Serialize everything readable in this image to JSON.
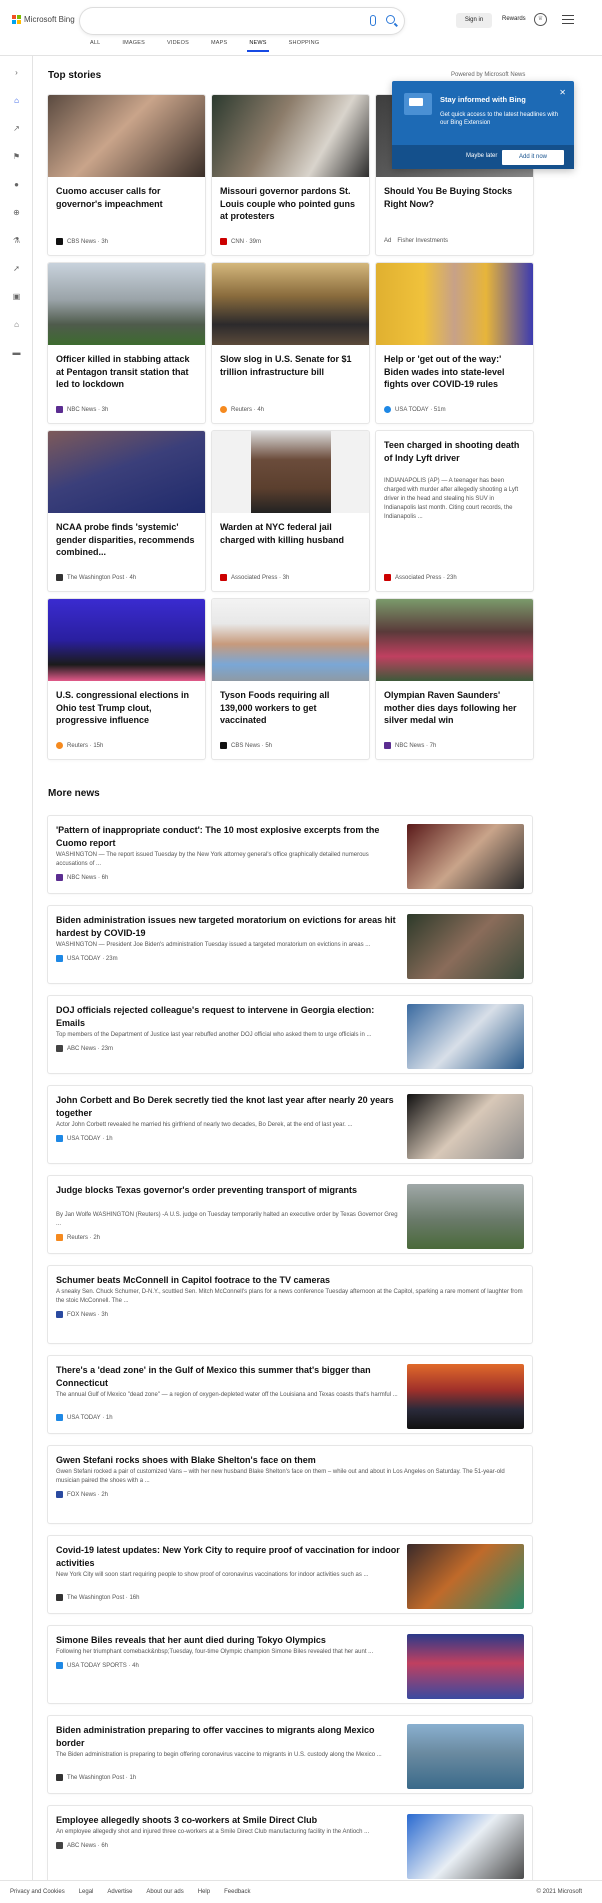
{
  "header": {
    "logo_text": "Microsoft Bing",
    "signin": "Sign in",
    "rewards": "Rewards",
    "tabs": [
      "ALL",
      "IMAGES",
      "VIDEOS",
      "MAPS",
      "NEWS",
      "SHOPPING"
    ],
    "active_tab": "NEWS"
  },
  "colors": {
    "accent": "#174ae4",
    "popup_bg": "#1d6ab5"
  },
  "top_stories": {
    "title": "Top stories",
    "powered_by": "Powered by Microsoft News",
    "cards": [
      {
        "headline": "Cuomo accuser calls for governor's impeachment",
        "source": "CBS News · 3h"
      },
      {
        "headline": "Missouri governor pardons St. Louis couple who pointed guns at protesters",
        "source": "CNN · 39m"
      },
      {
        "headline": "Should You Be Buying Stocks Right Now?",
        "source": "Fisher Investments",
        "ad": "Ad"
      },
      {
        "headline": "Officer killed in stabbing attack at Pentagon transit station that led to lockdown",
        "source": "NBC News · 3h"
      },
      {
        "headline": "Slow slog in U.S. Senate for $1 trillion infrastructure bill",
        "source": "Reuters · 4h"
      },
      {
        "headline": "Help or 'get out of the way:' Biden wades into state-level fights over COVID-19 rules",
        "source": "USA TODAY · 51m"
      },
      {
        "headline": "NCAA probe finds 'systemic' gender disparities, recommends combined...",
        "source": "The Washington Post · 4h"
      },
      {
        "headline": "Warden at NYC federal jail charged with killing husband",
        "source": "Associated Press · 3h"
      },
      {
        "headline": "Teen charged in shooting death of Indy Lyft driver",
        "snippet": "INDIANAPOLIS (AP) — A teenager has been charged with murder after allegedly shooting a Lyft driver in the head and stealing his SUV in Indianapolis last month. Citing court records, the Indianapolis ...",
        "source": "Associated Press · 23h"
      },
      {
        "headline": "U.S. congressional elections in Ohio test Trump clout, progressive influence",
        "source": "Reuters · 15h"
      },
      {
        "headline": "Tyson Foods requiring all 139,000 workers to get vaccinated",
        "source": "CBS News · 5h"
      },
      {
        "headline": "Olympian Raven Saunders' mother dies days following her silver medal win",
        "source": "NBC News · 7h"
      }
    ]
  },
  "popup": {
    "title": "Stay informed with Bing",
    "text": "Get quick access to the latest headlines with our Bing Extension",
    "later": "Maybe later",
    "add": "Add it now"
  },
  "more_news": {
    "title": "More news",
    "items": [
      {
        "headline": "'Pattern of inappropriate conduct': The 10 most explosive excerpts from the Cuomo report",
        "snippet": "WASHINGTON — The report issued Tuesday by the New York attorney general's office graphically detailed numerous accusations of ...",
        "source": "NBC News · 6h"
      },
      {
        "headline": "Biden administration issues new targeted moratorium on evictions for areas hit hardest by COVID-19",
        "snippet": "WASHINGTON — President Joe Biden's administration Tuesday issued a targeted moratorium on evictions in areas ...",
        "source": "USA TODAY · 23m"
      },
      {
        "headline": "DOJ officials rejected colleague's request to intervene in Georgia election: Emails",
        "snippet": "Top members of the Department of Justice last year rebuffed another DOJ official who asked them to urge officials in ...",
        "source": "ABC News · 23m"
      },
      {
        "headline": "John Corbett and Bo Derek secretly tied the knot last year after nearly 20 years together",
        "snippet": "Actor John Corbett revealed he married his girlfriend of nearly two decades, Bo Derek, at the end of last year. ...",
        "source": "USA TODAY · 1h"
      },
      {
        "headline": "Judge blocks Texas governor's order preventing transport of migrants",
        "snippet": "By Jan Wolfe WASHINGTON (Reuters) -A U.S. judge on Tuesday temporarily halted an executive order by Texas Governor Greg ...",
        "source": "Reuters · 2h"
      },
      {
        "headline": "Schumer beats McConnell in Capitol footrace to the TV cameras",
        "snippet": "A sneaky Sen. Chuck Schumer, D-N.Y., scuttled Sen. Mitch McConnell's plans for a news conference Tuesday afternoon at the Capitol, sparking a rare moment of laughter from the stoic McConnell. The ...",
        "source": "FOX News · 3h"
      },
      {
        "headline": "There's a 'dead zone' in the Gulf of Mexico this summer that's bigger than Connecticut",
        "snippet": "The annual Gulf of Mexico \"dead zone\" — a region of oxygen-depleted water off the Louisiana and Texas coasts that's harmful ...",
        "source": "USA TODAY · 1h"
      },
      {
        "headline": "Gwen Stefani rocks shoes with Blake Shelton's face on them",
        "snippet": "Gwen Stefani rocked a pair of customized Vans – with her new husband Blake Shelton's face on them – while out and about in Los Angeles on Saturday. The 51-year-old musician paired the shoes with a ...",
        "source": "FOX News · 2h"
      },
      {
        "headline": "Covid-19 latest updates: New York City to require proof of vaccination for indoor activities",
        "snippet": "New York City will soon start requiring people to show proof of coronavirus vaccinations for indoor activities such as ...",
        "source": "The Washington Post · 16h"
      },
      {
        "headline": "Simone Biles reveals that her aunt died during Tokyo Olympics",
        "snippet": "Following her triumphant comeback&nbsp;Tuesday, four-time Olympic champion Simone Biles revealed that her aunt ...",
        "source": "USA TODAY SPORTS · 4h"
      },
      {
        "headline": "Biden administration preparing to offer vaccines to migrants along Mexico border",
        "snippet": "The Biden administration is preparing to begin offering coronavirus vaccine to migrants in U.S. custody along the Mexico ...",
        "source": "The Washington Post · 1h"
      },
      {
        "headline": "Employee allegedly shoots 3 co-workers at Smile Direct Club",
        "snippet": "An employee allegedly shot and injured three co-workers at a Smile Direct Club manufacturing facility in the Antioch ...",
        "source": "ABC News · 6h"
      }
    ]
  },
  "footer": {
    "links": [
      "Privacy and Cookies",
      "Legal",
      "Advertise",
      "About our ads",
      "Help",
      "Feedback"
    ],
    "copyright": "© 2021 Microsoft"
  }
}
